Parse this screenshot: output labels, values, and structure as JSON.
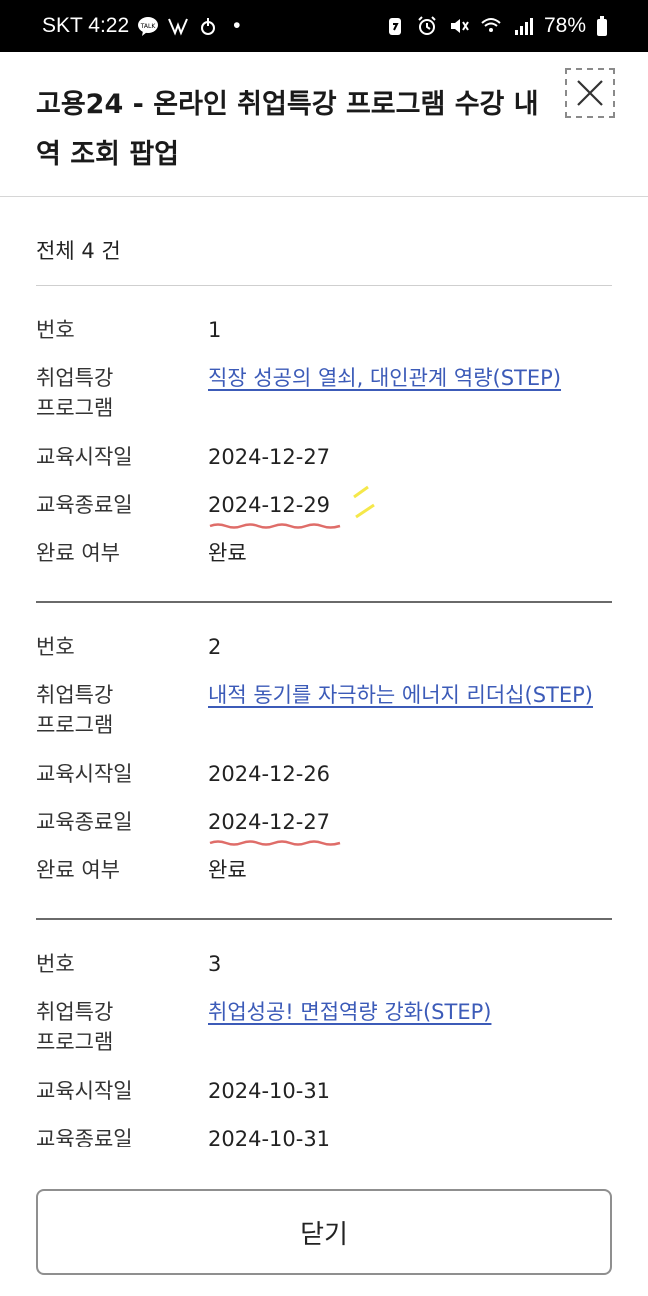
{
  "status_bar": {
    "carrier_time": "SKT 4:22",
    "dot": "•",
    "battery": "78%"
  },
  "header": {
    "title": "고용24 - 온라인 취업특강 프로그램 수강 내역 조회 팝업"
  },
  "summary": {
    "total": "전체 4 건"
  },
  "labels": {
    "number": "번호",
    "program": "취업특강\n프로그램",
    "start_date": "교육시작일",
    "end_date": "교육종료일",
    "completed": "완료 여부"
  },
  "records": [
    {
      "number": "1",
      "program": "직장 성공의 열쇠, 대인관계 역량(STEP)",
      "start_date": "2024-12-27",
      "end_date": "2024-12-29",
      "completed": "완료"
    },
    {
      "number": "2",
      "program": "내적 동기를 자극하는 에너지 리더십(STEP)",
      "start_date": "2024-12-26",
      "end_date": "2024-12-27",
      "completed": "완료"
    },
    {
      "number": "3",
      "program": "취업성공! 면접역량 강화(STEP)",
      "start_date": "2024-10-31",
      "end_date": "2024-10-31",
      "completed": ""
    }
  ],
  "footer": {
    "close_label": "닫기"
  },
  "colors": {
    "link": "#3c5bb8",
    "highlight_red": "#d9534f",
    "highlight_yellow": "#f5e84a"
  }
}
